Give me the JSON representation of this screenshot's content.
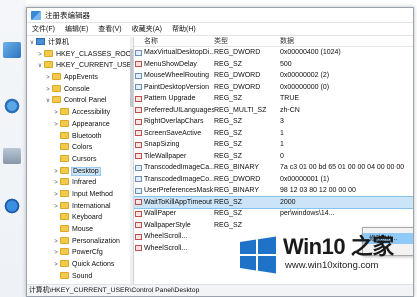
{
  "window": {
    "title": "注册表编辑器"
  },
  "menubar": [
    "文件(F)",
    "编辑(E)",
    "查看(V)",
    "收藏夹(A)",
    "帮助(H)"
  ],
  "tree": {
    "items": [
      {
        "label": "计算机",
        "level": 0,
        "arrow": "∨",
        "kind": "pc"
      },
      {
        "label": "HKEY_CLASSES_ROOT",
        "level": 1,
        "arrow": ">",
        "kind": "folder"
      },
      {
        "label": "HKEY_CURRENT_USER",
        "level": 1,
        "arrow": "∨",
        "kind": "folder"
      },
      {
        "label": "AppEvents",
        "level": 2,
        "arrow": ">",
        "kind": "folder"
      },
      {
        "label": "Console",
        "level": 2,
        "arrow": ">",
        "kind": "folder"
      },
      {
        "label": "Control Panel",
        "level": 2,
        "arrow": "∨",
        "kind": "folder"
      },
      {
        "label": "Accessibility",
        "level": 3,
        "arrow": ">",
        "kind": "folder"
      },
      {
        "label": "Appearance",
        "level": 3,
        "arrow": ">",
        "kind": "folder"
      },
      {
        "label": "Bluetooth",
        "level": 3,
        "arrow": "",
        "kind": "folder"
      },
      {
        "label": "Colors",
        "level": 3,
        "arrow": "",
        "kind": "folder"
      },
      {
        "label": "Cursors",
        "level": 3,
        "arrow": "",
        "kind": "folder"
      },
      {
        "label": "Desktop",
        "level": 3,
        "arrow": ">",
        "kind": "folder",
        "selected": true
      },
      {
        "label": "Infrared",
        "level": 3,
        "arrow": ">",
        "kind": "folder"
      },
      {
        "label": "Input Method",
        "level": 3,
        "arrow": ">",
        "kind": "folder"
      },
      {
        "label": "International",
        "level": 3,
        "arrow": ">",
        "kind": "folder"
      },
      {
        "label": "Keyboard",
        "level": 3,
        "arrow": "",
        "kind": "folder"
      },
      {
        "label": "Mouse",
        "level": 3,
        "arrow": "",
        "kind": "folder"
      },
      {
        "label": "Personalization",
        "level": 3,
        "arrow": ">",
        "kind": "folder"
      },
      {
        "label": "PowerCfg",
        "level": 3,
        "arrow": ">",
        "kind": "folder"
      },
      {
        "label": "Quick Actions",
        "level": 3,
        "arrow": ">",
        "kind": "folder"
      },
      {
        "label": "Sound",
        "level": 3,
        "arrow": "",
        "kind": "folder"
      }
    ]
  },
  "values": {
    "headers": {
      "name": "名称",
      "type": "类型",
      "data": "数据"
    },
    "rows": [
      {
        "name": "MaxVirtualDesktopDi...",
        "type": "REG_DWORD",
        "data": "0x00000400 (1024)",
        "sz": false
      },
      {
        "name": "MenuShowDelay",
        "type": "REG_SZ",
        "data": "500",
        "sz": true
      },
      {
        "name": "MouseWheelRouting",
        "type": "REG_DWORD",
        "data": "0x00000002 (2)",
        "sz": false
      },
      {
        "name": "PaintDesktopVersion",
        "type": "REG_DWORD",
        "data": "0x00000000 (0)",
        "sz": false
      },
      {
        "name": "Pattern Upgrade",
        "type": "REG_SZ",
        "data": "TRUE",
        "sz": true
      },
      {
        "name": "PreferredUILanguages",
        "type": "REG_MULTI_SZ",
        "data": "zh-CN",
        "sz": true
      },
      {
        "name": "RightOverlapChars",
        "type": "REG_SZ",
        "data": "3",
        "sz": true
      },
      {
        "name": "ScreenSaveActive",
        "type": "REG_SZ",
        "data": "1",
        "sz": true
      },
      {
        "name": "SnapSizing",
        "type": "REG_SZ",
        "data": "1",
        "sz": true
      },
      {
        "name": "TileWallpaper",
        "type": "REG_SZ",
        "data": "0",
        "sz": true
      },
      {
        "name": "TranscodedImageCa...",
        "type": "REG_BINARY",
        "data": "7a c3 01 00 bd 65 01 00 00 04 00 00 00",
        "sz": false
      },
      {
        "name": "TranscodedImageCo...",
        "type": "REG_DWORD",
        "data": "0x00000001 (1)",
        "sz": false
      },
      {
        "name": "UserPreferencesMask",
        "type": "REG_BINARY",
        "data": "98 12 03 80 12 00 00 00",
        "sz": false
      },
      {
        "name": "WaitToKillAppTimeout",
        "type": "REG_SZ",
        "data": "2000",
        "sz": true,
        "selected": true
      },
      {
        "name": "WallPaper",
        "type": "REG_SZ",
        "data": "per\\windows\\14...",
        "sz": true
      },
      {
        "name": "WallpaperStyle",
        "type": "REG_SZ",
        "data": "",
        "sz": true
      },
      {
        "name": "WheelScroll...",
        "type": "",
        "data": "",
        "sz": true
      },
      {
        "name": "WheelScroll...",
        "type": "",
        "data": "",
        "sz": true
      }
    ]
  },
  "context_menu": {
    "items": [
      "修改(M)..."
    ]
  },
  "statusbar": {
    "path": "计算机\\HKEY_CURRENT_USER\\Control Panel\\Desktop"
  },
  "watermark": {
    "title": "Win10 之家",
    "url": "www.win10xitong.com"
  },
  "colors": {
    "selection": "#cce4f7",
    "accent": "#0078d7",
    "arrow": "#e02020"
  }
}
